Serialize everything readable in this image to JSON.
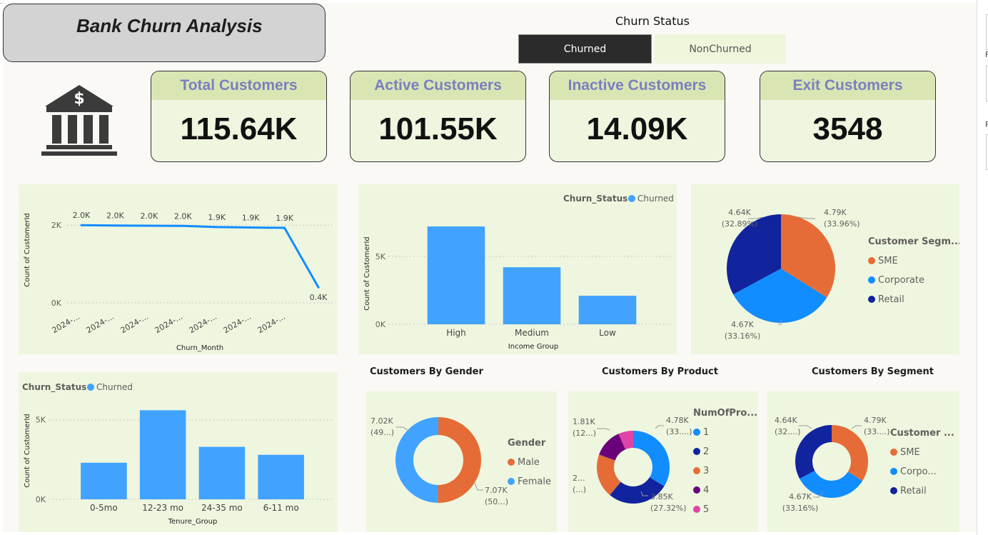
{
  "title": "Bank Churn Analysis",
  "slicer": {
    "title": "Churn Status",
    "options": [
      "Churned",
      "NonChurned"
    ],
    "selected": "Churned"
  },
  "kpis": [
    {
      "label": "Total Customers",
      "value": "115.64K"
    },
    {
      "label": "Active Customers",
      "value": "101.55K"
    },
    {
      "label": "Inactive Customers",
      "value": "14.09K"
    },
    {
      "label": "Exit Customers",
      "value": "3548"
    }
  ],
  "right_panel": {
    "letters": [
      "F",
      "F"
    ]
  },
  "colors": {
    "accent": "#41a3ff",
    "line": "#118dff",
    "orange": "#e66c37",
    "navy": "#12239e",
    "blue": "#118dff",
    "purple": "#6b007b",
    "pink": "#e044a7",
    "panel": "#eef6df",
    "kpi_head": "#d9e6b3",
    "kpi_label": "#7b7fbf"
  },
  "chart_data": [
    {
      "type": "line",
      "xlabel": "Churn_Month",
      "ylabel": "Count of CustomerId",
      "y_ticks": [
        "2K",
        "0K"
      ],
      "ylim": [
        0,
        2500
      ],
      "x": [
        "2024-...",
        "2024-...",
        "2024-...",
        "2024-...",
        "2024-...",
        "2024-...",
        "2024-..."
      ],
      "values": [
        2000,
        1990,
        1985,
        1980,
        1950,
        1940,
        1930,
        400
      ],
      "labels": [
        "2.0K",
        "2.0K",
        "2.0K",
        "2.0K",
        "1.9K",
        "1.9K",
        "1.9K",
        "0.4K"
      ]
    },
    {
      "type": "bar",
      "legend_title": "Churn_Status",
      "legend": [
        "Churned"
      ],
      "xlabel": "Income Group",
      "ylabel": "Count of CustomerId",
      "y_ticks": [
        "5K",
        "0K"
      ],
      "ylim": [
        0,
        8200
      ],
      "categories": [
        "High",
        "Medium",
        "Low"
      ],
      "values": [
        7200,
        4200,
        2100
      ]
    },
    {
      "type": "pie",
      "legend_title": "Customer Segm...",
      "legend": [
        "SME",
        "Corporate",
        "Retail"
      ],
      "values": [
        33.96,
        33.16,
        32.89
      ],
      "labels": [
        [
          "4.79K",
          "(33.96%)"
        ],
        [
          "4.67K",
          "(33.16%)"
        ],
        [
          "4.64K",
          "(32.89%)"
        ]
      ]
    },
    {
      "type": "bar",
      "legend_title": "Churn_Status",
      "legend": [
        "Churned"
      ],
      "xlabel": "Tenure_Group",
      "ylabel": "Count of CustomerId",
      "y_ticks": [
        "5K",
        "0K"
      ],
      "ylim": [
        0,
        6200
      ],
      "categories": [
        "0-5mo",
        "12-23 mo",
        "24-35 mo",
        "6-11 mo"
      ],
      "values": [
        2300,
        5600,
        3300,
        2800
      ]
    },
    {
      "type": "pie",
      "title": "Customers By Gender",
      "legend_title": "Gender",
      "legend": [
        "Male",
        "Female"
      ],
      "values": [
        50.2,
        49.8
      ],
      "labels": [
        [
          "7.07K",
          "(50...)"
        ],
        [
          "7.02K",
          "(49...)"
        ]
      ]
    },
    {
      "type": "pie",
      "title": "Customers By Product",
      "legend_title": "NumOfPro...",
      "legend": [
        "1",
        "2",
        "3",
        "4",
        "5"
      ],
      "values": [
        33.8,
        27.32,
        19.5,
        12.8,
        6.58
      ],
      "labels": [
        [
          "4.78K",
          "(33....)"
        ],
        [
          "3.85K",
          "(27.32%)"
        ],
        [
          "2...",
          "(...)"
        ],
        [
          "1.81K",
          "(12...)"
        ],
        [
          "",
          ""
        ]
      ]
    },
    {
      "type": "pie",
      "title": "Customers By Segment",
      "legend_title": "Customer ...",
      "legend": [
        "SME",
        "Corpo...",
        "Retail"
      ],
      "values": [
        33.96,
        33.16,
        32.89
      ],
      "labels": [
        [
          "4.79K",
          "(33....)"
        ],
        [
          "4.67K",
          "(33.16%)"
        ],
        [
          "4.64K",
          "(32....)"
        ]
      ]
    }
  ]
}
